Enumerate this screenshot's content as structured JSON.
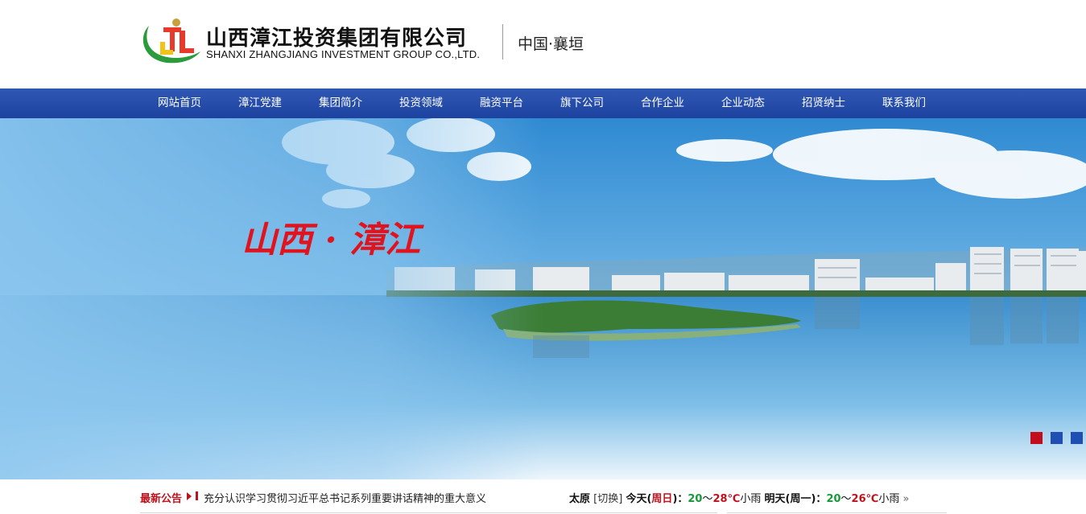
{
  "header": {
    "company_cn": "山西漳江投资集团有限公司",
    "company_en": "SHANXI ZHANGJIANG INVESTMENT GROUP CO.,LTD.",
    "slogan": "中国·襄垣",
    "logo_letters": "ZJL",
    "logo_icon": "zhangjiang-logo-icon"
  },
  "nav": {
    "items": [
      {
        "label": "网站首页"
      },
      {
        "label": "漳江党建"
      },
      {
        "label": "集团简介"
      },
      {
        "label": "投资领域"
      },
      {
        "label": "融资平台"
      },
      {
        "label": "旗下公司"
      },
      {
        "label": "合作企业"
      },
      {
        "label": "企业动态"
      },
      {
        "label": "招贤纳士"
      },
      {
        "label": "联系我们"
      }
    ]
  },
  "banner": {
    "calligraphy": "山西 · 漳江",
    "slides_total": 3,
    "active_slide": 1,
    "colors": {
      "active_dot": "#c40d1a",
      "inactive_dot": "#1f4fb2"
    }
  },
  "notice": {
    "label": "最新公告",
    "text": "充分认识学习贯彻习近平总书记系列重要讲话精神的重大意义"
  },
  "weather": {
    "city": "太原",
    "switch_label": "[切换]",
    "today_label": "今天",
    "today_day": "周日",
    "today_low": "20",
    "today_high": "28",
    "today_cond": "小雨",
    "tomorrow_label": "明天",
    "tomorrow_day": "周一",
    "tomorrow_low": "20",
    "tomorrow_high": "26",
    "tomorrow_cond": "小雨",
    "unit": "℃",
    "more_icon": "double-chevron-right-icon"
  },
  "colors": {
    "nav_bg": "#244aa8",
    "accent_red": "#c0121c",
    "temp_green": "#139b38"
  }
}
